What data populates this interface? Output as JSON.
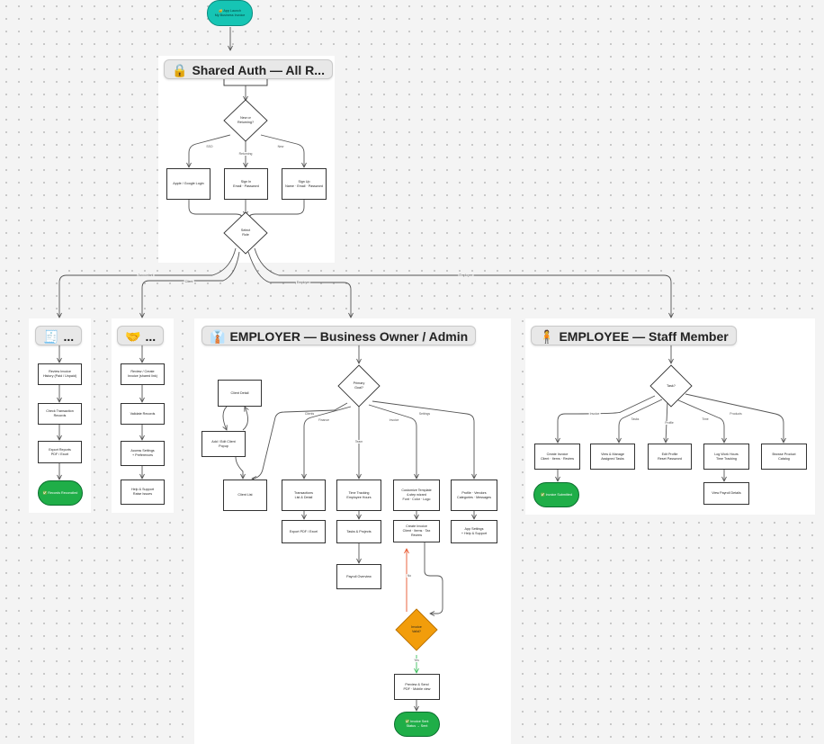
{
  "start": {
    "label": "🔐 App Launch\nMy Business Invoice"
  },
  "sections": {
    "auth": {
      "emoji": "🔒",
      "title": "Shared Auth — All R..."
    },
    "sidebar1": {
      "emoji": "🧾",
      "title": "..."
    },
    "sidebar2": {
      "emoji": "🤝",
      "title": "..."
    },
    "employer": {
      "emoji": "👔",
      "title": "EMPLOYER — Business Owner / Admin"
    },
    "employee": {
      "emoji": "🧍",
      "title": "EMPLOYEE — Staff Member"
    }
  },
  "auth": {
    "decision_new": "New or\nReturning?",
    "sso": "Apple / Google Login",
    "signin": "Sign In\nEmail · Password",
    "signup": "Sign Up\nName · Email · Password",
    "select_role": "Select\nRole",
    "edge_sso": "SSO",
    "edge_returning": "Returning",
    "edge_new": "New"
  },
  "role_edges": {
    "accountant": "Accountant",
    "client": "Client",
    "employer": "Employer",
    "employee": "Employee"
  },
  "sidebar1": {
    "items": [
      "Review Invoice\nHistory (Paid / Unpaid)",
      "Check Transaction\nRecords",
      "Export Reports\nPDF / Excel"
    ],
    "end": "✅ Records Reconciled"
  },
  "sidebar2": {
    "items": [
      "Review / Create\nInvoice (shared link)",
      "Validate Records",
      "Access Settings\n+ Preferences",
      "Help & Support\nRaise Issues"
    ]
  },
  "employer": {
    "primary_goal": "Primary\nGoal?",
    "client_detail": "Client Detail",
    "add_edit_client": "Add / Edit Client\nPopup",
    "client_list": "Client List",
    "transactions": "Transactions\nList & Detail",
    "export": "Export PDF / Excel",
    "time_tracking": "Time Tracking\nEmployee Hours",
    "tasks_projects": "Tasks & Projects",
    "payroll": "Payroll Overview",
    "customize_template": "Customize Template\n4-step wizard\nFont · Color · Logo",
    "create_invoice": "Create Invoice\nClient · Items · Tax\nReview",
    "invoice_valid": "Invoice\nValid?",
    "preview_send": "Preview & Send\nPDF · Mobile view",
    "invoice_sent": "✅ Invoice Sent\nStatus → Sent",
    "profile": "Profile · Vendors\nCategories · Messages",
    "app_settings": "App Settings\n+ Help & Support",
    "edge_clients": "Clients",
    "edge_finance": "Finance",
    "edge_team": "Team",
    "edge_invoice": "Invoice",
    "edge_settings": "Settings",
    "edge_no": "No",
    "edge_yes": "Yes"
  },
  "employee": {
    "task": "Task?",
    "create_invoice": "Create Invoice\nClient · Items · Review",
    "view_tasks": "View & Manage\nAssigned Tasks",
    "edit_profile": "Edit Profile\nReset Password",
    "log_work": "Log Work Hours\nTime Tracking",
    "browse_catalog": "Browse Product\nCatalog",
    "payroll_details": "View Payroll Details",
    "end": "✅ Invoice Submitted",
    "edge_invoice": "Invoice",
    "edge_tasks": "Tasks",
    "edge_profile": "Profile",
    "edge_time": "Time",
    "edge_products": "Products"
  },
  "colors": {
    "start_node": "#16c5b4",
    "end_node": "#1fae48",
    "decision_warning": "#f29d0b",
    "edge_no": "#e8552b",
    "edge_yes": "#3fbf5f",
    "edge_default": "#555555"
  }
}
